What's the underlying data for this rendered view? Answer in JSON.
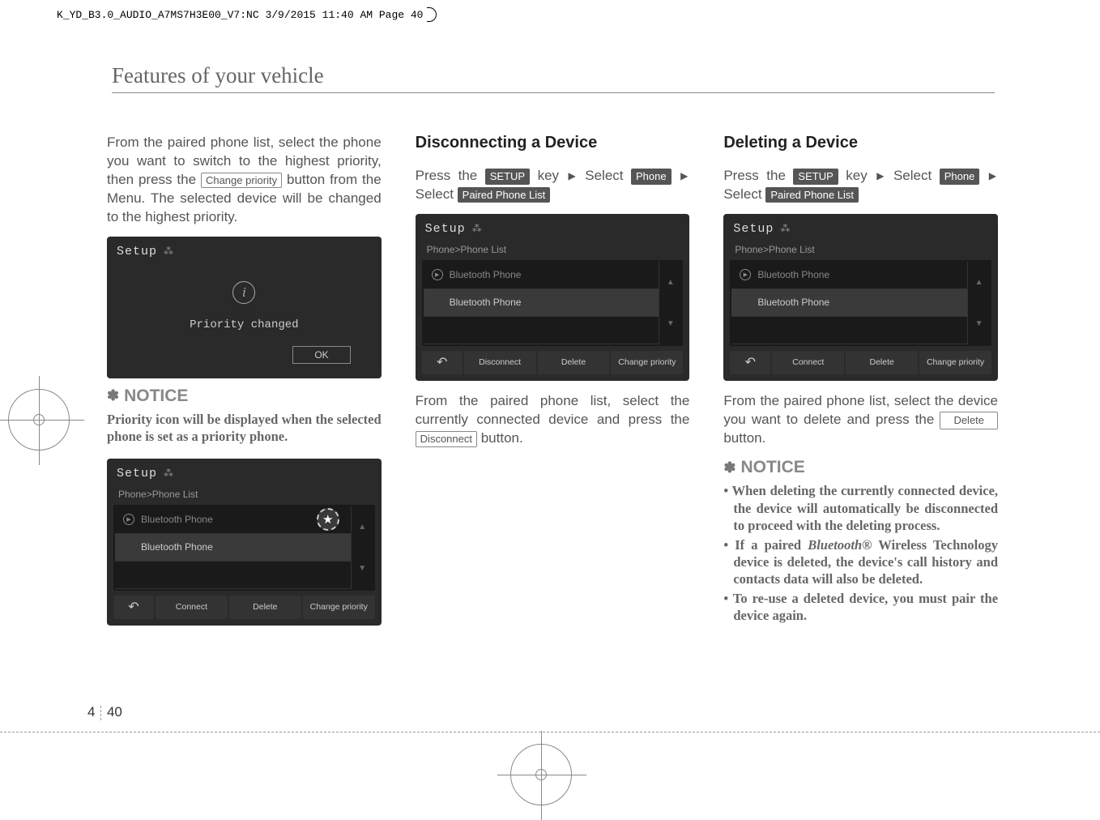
{
  "header_file": "K_YD_B3.0_AUDIO_A7MS7H3E00_V7:NC  3/9/2015  11:40 AM  Page 40",
  "page_header": "Features of your vehicle",
  "page_section": "4",
  "page_number": "40",
  "col1": {
    "para1_a": "From the paired phone list, select the phone you want to switch to the highest priority, then press the ",
    "change_priority_btn": "Change priority",
    "para1_b": " button from the Menu. The selected device will be changed to the highest priority.",
    "screen1": {
      "setup": "Setup",
      "msg": "Priority changed",
      "ok": "OK"
    },
    "notice_marker": "✽",
    "notice_heading": "NOTICE",
    "notice_body": "Priority icon will be displayed when the selected phone is set as a priority phone.",
    "screen2": {
      "setup": "Setup",
      "breadcrumb": "Phone>Phone List",
      "row1": "Bluetooth Phone",
      "row2": "Bluetooth Phone",
      "btn_connect": "Connect",
      "btn_delete": "Delete",
      "btn_change": "Change priority"
    }
  },
  "col2": {
    "heading": "Disconnecting a Device",
    "press_the": "Press the ",
    "setup_key": "SETUP",
    "key_select": " key ",
    "select": " Select ",
    "phone_btn": "Phone",
    "arrow_select": " Select ",
    "paired_list_btn": "Paired Phone List",
    "screen": {
      "setup": "Setup",
      "breadcrumb": "Phone>Phone List",
      "row1": "Bluetooth Phone",
      "row2": "Bluetooth Phone",
      "btn_disconnect": "Disconnect",
      "btn_delete": "Delete",
      "btn_change": "Change priority"
    },
    "para2_a": "From the paired phone list, select the currently connected device and press the ",
    "disconnect_btn": "Disconnect",
    "para2_b": " button."
  },
  "col3": {
    "heading": "Deleting a Device",
    "press_the": "Press the ",
    "setup_key": "SETUP",
    "key_select": " key ",
    "select": " Select ",
    "phone_btn": "Phone",
    "arrow_select": " Select ",
    "paired_list_btn": "Paired Phone List",
    "screen": {
      "setup": "Setup",
      "breadcrumb": "Phone>Phone List",
      "row1": "Bluetooth Phone",
      "row2": "Bluetooth Phone",
      "btn_connect": "Connect",
      "btn_delete": "Delete",
      "btn_change": "Change priority"
    },
    "para2_a": "From the paired phone list, select the device you want to delete and press the ",
    "delete_btn": "Delete",
    "para2_b": " button.",
    "notice_marker": "✽",
    "notice_heading": "NOTICE",
    "notice_item1": "When deleting the currently connected device, the device will automatically be disconnected to proceed with the deleting process.",
    "notice_item2_a": "If a paired ",
    "notice_item2_bt": "Bluetooth",
    "notice_item2_b": "®  Wireless Technology device is deleted, the device's call history and contacts data will also be deleted.",
    "notice_item3": "To re-use a deleted device, you must pair the device again."
  }
}
